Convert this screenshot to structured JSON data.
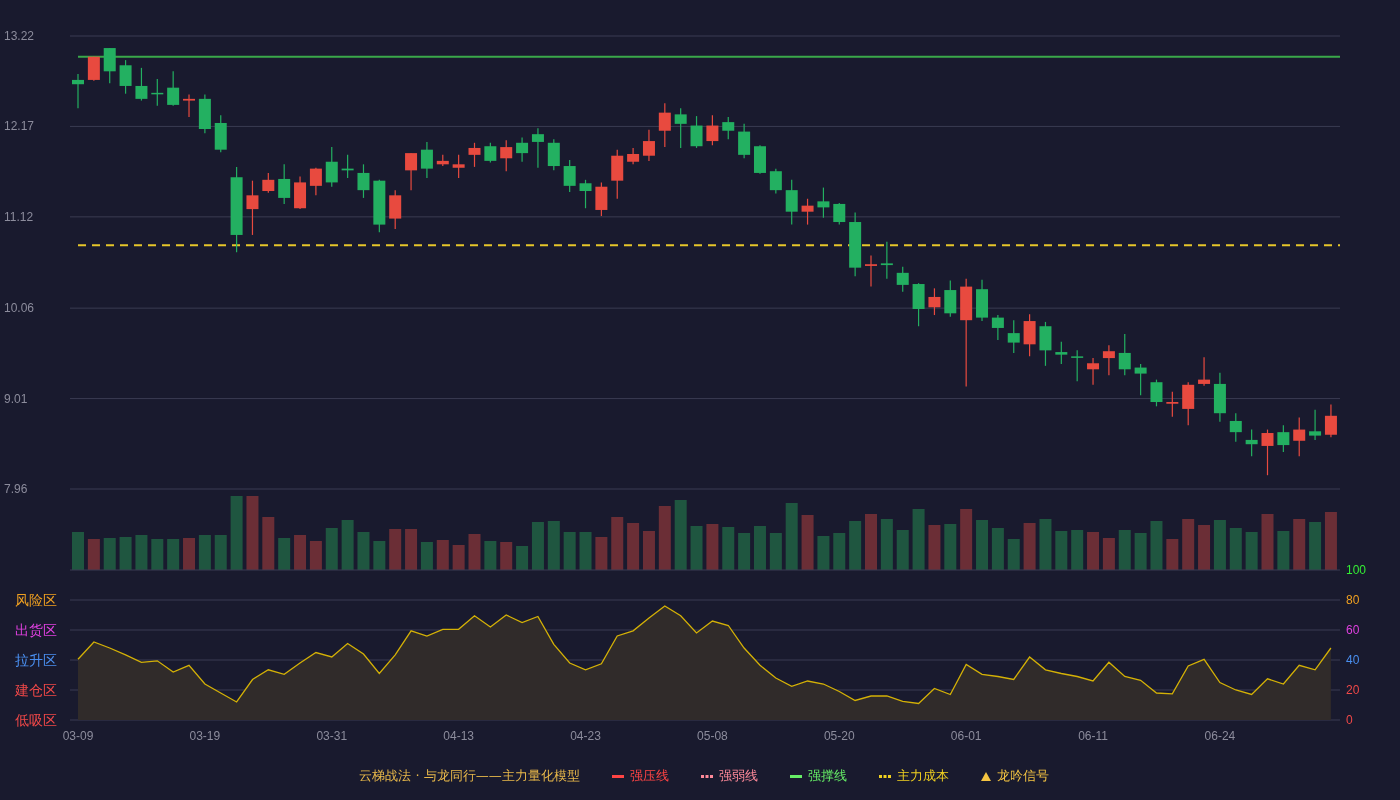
{
  "price_chart": {
    "chart_data": {
      "type": "candlestick",
      "grid": true,
      "ylim": [
        7.96,
        13.22
      ],
      "yticks": [
        {
          "value": 13.22,
          "label": "13.22"
        },
        {
          "value": 12.17,
          "label": "12.17"
        },
        {
          "value": 11.12,
          "label": "11.12"
        },
        {
          "value": 10.06,
          "label": "10.06"
        },
        {
          "value": 9.01,
          "label": "9.01"
        },
        {
          "value": 7.96,
          "label": "7.96"
        }
      ],
      "ohlc": [
        [
          12.71,
          12.78,
          12.38,
          12.66
        ],
        [
          12.71,
          12.98,
          12.7,
          12.98
        ],
        [
          13.08,
          13.08,
          12.67,
          12.81
        ],
        [
          12.88,
          12.94,
          12.55,
          12.64
        ],
        [
          12.64,
          12.85,
          12.47,
          12.49
        ],
        [
          12.56,
          12.72,
          12.41,
          12.55
        ],
        [
          12.62,
          12.81,
          12.41,
          12.42
        ],
        [
          12.47,
          12.54,
          12.28,
          12.49
        ],
        [
          12.49,
          12.54,
          12.09,
          12.14
        ],
        [
          12.21,
          12.3,
          11.87,
          11.9
        ],
        [
          11.58,
          11.7,
          10.71,
          10.91
        ],
        [
          11.21,
          11.54,
          10.91,
          11.37
        ],
        [
          11.42,
          11.63,
          11.4,
          11.55
        ],
        [
          11.56,
          11.73,
          11.27,
          11.34
        ],
        [
          11.22,
          11.59,
          11.21,
          11.52
        ],
        [
          11.48,
          11.69,
          11.37,
          11.68
        ],
        [
          11.76,
          11.93,
          11.47,
          11.52
        ],
        [
          11.68,
          11.84,
          11.57,
          11.66
        ],
        [
          11.63,
          11.73,
          11.34,
          11.43
        ],
        [
          11.54,
          11.55,
          10.94,
          11.03
        ],
        [
          11.1,
          11.43,
          10.98,
          11.37
        ],
        [
          11.66,
          11.86,
          11.43,
          11.86
        ],
        [
          11.9,
          11.99,
          11.57,
          11.68
        ],
        [
          11.73,
          11.84,
          11.71,
          11.77
        ],
        [
          11.69,
          11.84,
          11.57,
          11.73
        ],
        [
          11.84,
          11.98,
          11.7,
          11.92
        ],
        [
          11.94,
          11.98,
          11.75,
          11.77
        ],
        [
          11.8,
          12.01,
          11.65,
          11.93
        ],
        [
          11.98,
          12.04,
          11.76,
          11.86
        ],
        [
          12.08,
          12.15,
          11.69,
          11.99
        ],
        [
          11.98,
          12.02,
          11.66,
          11.71
        ],
        [
          11.71,
          11.78,
          11.41,
          11.48
        ],
        [
          11.51,
          11.55,
          11.22,
          11.42
        ],
        [
          11.2,
          11.52,
          11.13,
          11.47
        ],
        [
          11.54,
          11.9,
          11.33,
          11.83
        ],
        [
          11.76,
          11.92,
          11.73,
          11.85
        ],
        [
          11.83,
          12.13,
          11.77,
          12.0
        ],
        [
          12.12,
          12.44,
          11.93,
          12.33
        ],
        [
          12.31,
          12.38,
          11.92,
          12.2
        ],
        [
          12.18,
          12.29,
          11.92,
          11.94
        ],
        [
          12.0,
          12.3,
          11.95,
          12.18
        ],
        [
          12.22,
          12.28,
          12.02,
          12.12
        ],
        [
          12.11,
          12.2,
          11.8,
          11.84
        ],
        [
          11.94,
          11.95,
          11.62,
          11.63
        ],
        [
          11.65,
          11.68,
          11.39,
          11.43
        ],
        [
          11.43,
          11.55,
          11.03,
          11.18
        ],
        [
          11.18,
          11.33,
          11.03,
          11.25
        ],
        [
          11.3,
          11.46,
          11.11,
          11.23
        ],
        [
          11.27,
          11.28,
          11.03,
          11.06
        ],
        [
          11.06,
          11.17,
          10.43,
          10.53
        ],
        [
          10.55,
          10.67,
          10.31,
          10.57
        ],
        [
          10.58,
          10.83,
          10.4,
          10.56
        ],
        [
          10.47,
          10.54,
          10.25,
          10.33
        ],
        [
          10.34,
          10.35,
          9.85,
          10.05
        ],
        [
          10.07,
          10.29,
          9.98,
          10.19
        ],
        [
          10.27,
          10.38,
          9.96,
          10.0
        ],
        [
          9.92,
          10.4,
          9.15,
          10.31
        ],
        [
          10.28,
          10.39,
          9.91,
          9.95
        ],
        [
          9.95,
          9.98,
          9.69,
          9.83
        ],
        [
          9.77,
          9.92,
          9.54,
          9.66
        ],
        [
          9.64,
          9.99,
          9.5,
          9.91
        ],
        [
          9.85,
          9.9,
          9.39,
          9.57
        ],
        [
          9.55,
          9.67,
          9.41,
          9.52
        ],
        [
          9.5,
          9.57,
          9.21,
          9.49
        ],
        [
          9.35,
          9.48,
          9.17,
          9.42
        ],
        [
          9.48,
          9.63,
          9.28,
          9.56
        ],
        [
          9.54,
          9.76,
          9.28,
          9.35
        ],
        [
          9.37,
          9.41,
          9.05,
          9.3
        ],
        [
          9.2,
          9.23,
          8.92,
          8.97
        ],
        [
          8.95,
          9.09,
          8.8,
          8.97
        ],
        [
          8.89,
          9.2,
          8.7,
          9.17
        ],
        [
          9.18,
          9.49,
          9.16,
          9.23
        ],
        [
          9.18,
          9.31,
          8.74,
          8.84
        ],
        [
          8.75,
          8.84,
          8.51,
          8.62
        ],
        [
          8.53,
          8.65,
          8.34,
          8.48
        ],
        [
          8.46,
          8.65,
          8.12,
          8.61
        ],
        [
          8.62,
          8.7,
          8.39,
          8.47
        ],
        [
          8.52,
          8.79,
          8.34,
          8.65
        ],
        [
          8.63,
          8.88,
          8.53,
          8.58
        ],
        [
          8.59,
          8.94,
          8.56,
          8.81
        ]
      ],
      "ref_lines": [
        {
          "axis": "y",
          "value": 12.98,
          "color": "#3aa84a"
        },
        {
          "axis": "y",
          "value": 10.79,
          "color": "#e6c62a"
        }
      ]
    },
    "ref_line_styles": [
      {
        "kind": "solid"
      },
      {
        "kind": "dashed"
      }
    ]
  },
  "oscillator": {
    "zones": [
      {
        "label": "风险区",
        "color": "#f0a020"
      },
      {
        "label": "出货区",
        "color": "#e040e0"
      },
      {
        "label": "拉升区",
        "color": "#4a8ff0"
      },
      {
        "label": "建仓区",
        "color": "#f04848"
      },
      {
        "label": "低吸区",
        "color": "#f04848"
      }
    ],
    "date_labels": [
      "03-09",
      "03-19",
      "03-31",
      "04-13",
      "04-23",
      "05-08",
      "05-20",
      "06-01",
      "06-11",
      "06-24"
    ],
    "chart_data": {
      "type": "area",
      "grid": true,
      "ylim": [
        0,
        100
      ],
      "yticks": [
        {
          "value": 100,
          "label": "100"
        },
        {
          "value": 80,
          "label": "80"
        },
        {
          "value": 60,
          "label": "60"
        },
        {
          "value": 40,
          "label": "40"
        },
        {
          "value": 20,
          "label": "20"
        },
        {
          "value": 0,
          "label": "0"
        }
      ],
      "series": [
        {
          "color": "#d4b106",
          "values": [
            40.5,
            52,
            48,
            43.5,
            38.5,
            39.5,
            32,
            36.5,
            24,
            18,
            12,
            27,
            33.5,
            30.5,
            38,
            45,
            42,
            51,
            44,
            31,
            43.5,
            59.5,
            56,
            60.5,
            60.5,
            69.5,
            62,
            70,
            65,
            69,
            50.5,
            38,
            33.5,
            37.5,
            56,
            59.5,
            68,
            76,
            69.5,
            58,
            66,
            63,
            48,
            36.5,
            28,
            22.5,
            26,
            24,
            19,
            13,
            16,
            16,
            12.5,
            11,
            21,
            17,
            37,
            30.5,
            29,
            27,
            42,
            33.5,
            31,
            29,
            26,
            38.5,
            29,
            26.5,
            18,
            17.5,
            36,
            40.5,
            25,
            20,
            17,
            27.5,
            24,
            36.5,
            33.5,
            48
          ]
        }
      ]
    }
  },
  "legend": {
    "title": "云梯战法 · 与龙同行——主力量化模型",
    "items": [
      {
        "kind": "solid",
        "label": "强压线",
        "color": "#ff4444"
      },
      {
        "kind": "dashed",
        "label": "强弱线",
        "color": "#ff8a9a"
      },
      {
        "kind": "solid",
        "label": "强撑线",
        "color": "#66ee66"
      },
      {
        "kind": "dashed",
        "label": "主力成本",
        "color": "#f0d020"
      },
      {
        "kind": "triangle",
        "label": "龙吟信号",
        "color": "#f5c542"
      }
    ]
  }
}
